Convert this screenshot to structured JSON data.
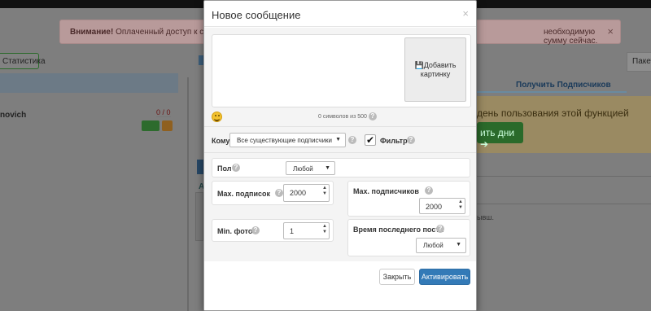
{
  "background": {
    "alert": {
      "strong": "Внимание!",
      "text": "Оплаченный доступ к сервису",
      "text_right": "необходимую сумму сейчас.",
      "close": "×"
    },
    "stats_button": "Статистика",
    "user_name": "novich",
    "user_counter": "0 / 0",
    "package_label": "Пакет",
    "tab_label": "Получить Подписчиков",
    "info_text": "день пользования этой функцией",
    "info_button": "ить дни ➔",
    "tab_a": "А",
    "row_text": "ывш."
  },
  "modal": {
    "title": "Новое сообщение",
    "close": "×",
    "add_image_label": "Добавить картинку",
    "counter": "0 символов из 500",
    "recipient_label": "Кому",
    "recipient_value": "Все существующие подписчики",
    "filter_label": "Фильтр",
    "filter_checked": true,
    "gender_label": "Пол",
    "gender_value": "Любой",
    "max_subscriptions_label": "Max. подписок",
    "max_subscriptions_value": "2000",
    "max_followers_label": "Max. подписчиков",
    "max_followers_value": "2000",
    "min_photos_label": "Min. фото",
    "min_photos_value": "1",
    "last_post_label": "Время последнего поста",
    "last_post_value": "Любой",
    "close_button": "Закрыть",
    "activate_button": "Активировать"
  },
  "colors": {
    "primary": "#337ab7",
    "overlay": "#7e7e7e"
  }
}
